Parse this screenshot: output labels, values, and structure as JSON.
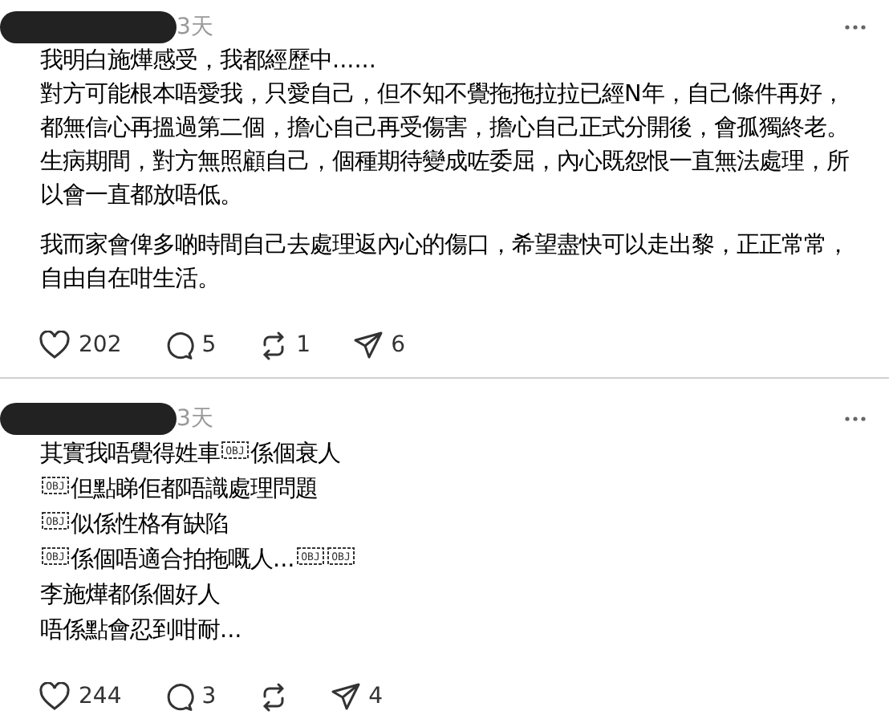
{
  "posts": [
    {
      "time": "3天",
      "paragraphs": [
        "我明白施燁感受，我都經歷中......\n對方可能根本唔愛我，只愛自己，但不知不覺拖拖拉拉已經N年，自己條件再好，都無信心再搵過第二個，擔心自己再受傷害，擔心自己正式分開後，會孤獨終老。生病期間，對方無照顧自己，個種期待變成咗委屈，內心既怨恨一直無法處理，所以會一直都放唔低。",
        "我而家會俾多啲時間自己去處理返內心的傷口，希望盡快可以走出黎，正正常常，自由自在咁生活。"
      ],
      "actions": {
        "likes": "202",
        "replies": "5",
        "reposts": "1",
        "shares": "6"
      }
    },
    {
      "time": "3天",
      "lines": [
        [
          {
            "kind": "text",
            "text": "其實我唔覺得姓車"
          },
          {
            "kind": "obj",
            "text": "OBJ"
          },
          {
            "kind": "text",
            "text": "係個衰人"
          }
        ],
        [
          {
            "kind": "obj",
            "text": "OBJ"
          },
          {
            "kind": "text",
            "text": "但點睇佢都唔識處理問題"
          }
        ],
        [
          {
            "kind": "obj",
            "text": "OBJ"
          },
          {
            "kind": "text",
            "text": "似係性格有缺陷"
          }
        ],
        [
          {
            "kind": "obj",
            "text": "OBJ"
          },
          {
            "kind": "text",
            "text": "係個唔適合拍拖嘅人..."
          },
          {
            "kind": "obj",
            "text": "OBJ"
          },
          {
            "kind": "obj",
            "text": "OBJ"
          }
        ],
        [
          {
            "kind": "text",
            "text": "李施燁都係個好人"
          }
        ],
        [
          {
            "kind": "text",
            "text": "唔係點會忍到咁耐..."
          }
        ]
      ],
      "actions": {
        "likes": "244",
        "replies": "3",
        "shares": "4"
      }
    }
  ]
}
